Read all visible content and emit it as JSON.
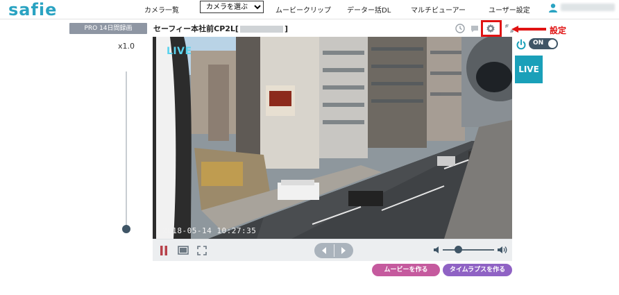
{
  "app": {
    "logo": "safie"
  },
  "nav": {
    "camera_list": "カメラ一覧",
    "camera_select": {
      "value": "カメラを選ぶ"
    },
    "movie_clip": "ムービークリップ",
    "data_bulk_dl": "データー括DL",
    "multi_viewer": "マルチビューアー",
    "user_settings": "ユーザー設定"
  },
  "left": {
    "plan_badge": "PRO 14日間録画",
    "zoom": "x1.0"
  },
  "camera": {
    "title_prefix": "セーフィー本社前CP2L[",
    "title_suffix": "]"
  },
  "annotation": {
    "label": "設定",
    "color": "#e01313"
  },
  "video": {
    "live_label": "LIVE",
    "timestamp": "2018-05-14 10:27:35"
  },
  "controls": {
    "power_state": "ON",
    "live_button": "LIVE",
    "volume_level": 0.3
  },
  "actions": {
    "make_movie": "ムービーを作る",
    "make_timelapse": "タイムラプスを作る"
  },
  "icons": [
    "user-icon",
    "clock-icon",
    "chat-icon",
    "gear-icon",
    "expand-icon",
    "power-icon",
    "pause-icon",
    "screen-icon",
    "fullscreen-icon",
    "prev-icon",
    "next-icon",
    "volume-low-icon",
    "volume-high-icon"
  ],
  "colors": {
    "brand": "#2aa3c2",
    "live": "#1aa0b9",
    "movie": "#c55a9e",
    "timelapse": "#8f62c4",
    "dark": "#3f5566"
  }
}
